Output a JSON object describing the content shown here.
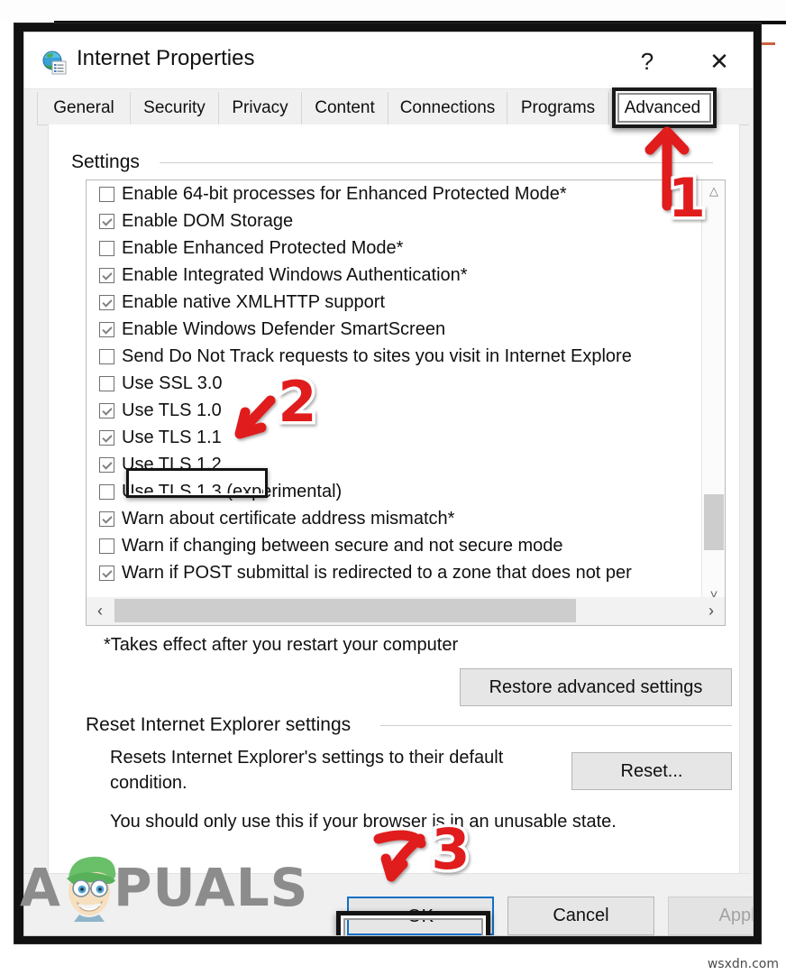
{
  "window": {
    "title": "Internet Properties",
    "icon": "globe-settings-icon",
    "help_button": "?",
    "close_button": "✕"
  },
  "tabs": [
    {
      "label": "General",
      "active": false
    },
    {
      "label": "Security",
      "active": false
    },
    {
      "label": "Privacy",
      "active": false
    },
    {
      "label": "Content",
      "active": false
    },
    {
      "label": "Connections",
      "active": false
    },
    {
      "label": "Programs",
      "active": false
    },
    {
      "label": "Advanced",
      "active": true
    }
  ],
  "settings_group": {
    "label": "Settings",
    "items": [
      {
        "label": "Enable 64-bit processes for Enhanced Protected Mode*",
        "checked": false
      },
      {
        "label": "Enable DOM Storage",
        "checked": true
      },
      {
        "label": "Enable Enhanced Protected Mode*",
        "checked": false
      },
      {
        "label": "Enable Integrated Windows Authentication*",
        "checked": true
      },
      {
        "label": "Enable native XMLHTTP support",
        "checked": true
      },
      {
        "label": "Enable Windows Defender SmartScreen",
        "checked": true
      },
      {
        "label": "Send Do Not Track requests to sites you visit in Internet Explore",
        "checked": false
      },
      {
        "label": "Use SSL 3.0",
        "checked": false
      },
      {
        "label": "Use TLS 1.0",
        "checked": true
      },
      {
        "label": "Use TLS 1.1",
        "checked": true
      },
      {
        "label": "Use TLS 1.2",
        "checked": true
      },
      {
        "label": "Use TLS 1.3 (experimental)",
        "checked": false
      },
      {
        "label": "Warn about certificate address mismatch*",
        "checked": true
      },
      {
        "label": "Warn if changing between secure and not secure mode",
        "checked": false
      },
      {
        "label": "Warn if POST submittal is redirected to a zone that does not per",
        "checked": true
      }
    ],
    "scroll_up_icon": "chevron-up-icon",
    "scroll_down_icon": "chevron-down-icon",
    "scroll_left_icon": "chevron-left-icon",
    "scroll_right_icon": "chevron-right-icon"
  },
  "footnote": "*Takes effect after you restart your computer",
  "restore_button": "Restore advanced settings",
  "reset_group": {
    "label": "Reset Internet Explorer settings",
    "description": "Resets Internet Explorer's settings to their default condition.",
    "button": "Reset...",
    "note": "You should only use this if your browser is in an unusable state."
  },
  "footer": {
    "ok": "OK",
    "cancel": "Cancel",
    "apply": "Apply"
  },
  "annotations": [
    {
      "number": "1",
      "target": "advanced-tab",
      "color": "#e01b1b"
    },
    {
      "number": "2",
      "target": "use-tls-1.2-checkbox",
      "color": "#e01b1b"
    },
    {
      "number": "3",
      "target": "ok-button",
      "color": "#e01b1b"
    }
  ],
  "watermarks": {
    "brand": "PUALS",
    "brand_prefix": "A",
    "site": "wsxdn.com"
  },
  "colors": {
    "accent_red": "#e01b1b",
    "focus_blue": "#1170c5",
    "highlight_black": "#141414",
    "window_bg": "#f0f0f0",
    "panel_bg": "#ffffff"
  }
}
